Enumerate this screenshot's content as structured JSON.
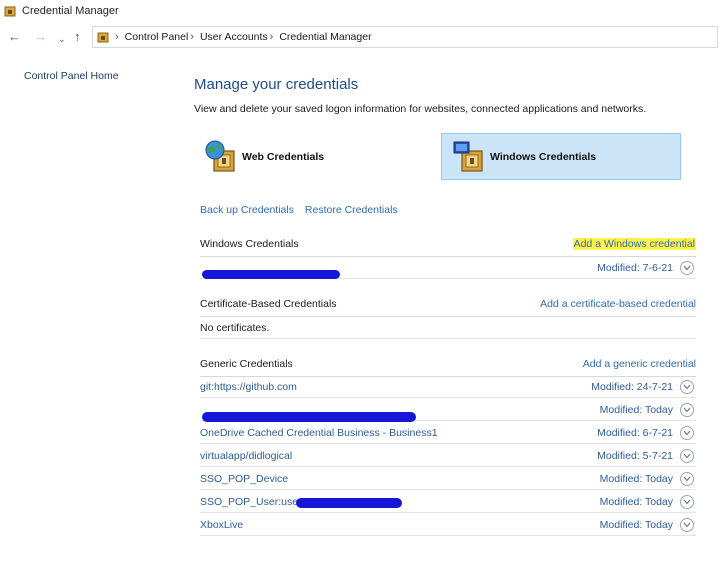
{
  "window": {
    "title": "Credential Manager"
  },
  "breadcrumb": {
    "items": [
      "Control Panel",
      "User Accounts",
      "Credential Manager"
    ]
  },
  "sidebar": {
    "home_link": "Control Panel Home"
  },
  "main": {
    "title": "Manage your credentials",
    "subtitle": "View and delete your saved logon information for websites, connected applications and networks.",
    "tiles": [
      {
        "label": "Web Credentials",
        "selected": false
      },
      {
        "label": "Windows Credentials",
        "selected": true
      }
    ],
    "actions": {
      "backup": "Back up Credentials",
      "restore": "Restore Credentials"
    }
  },
  "sections": {
    "windows": {
      "title": "Windows Credentials",
      "add": "Add a Windows credential",
      "rows": [
        {
          "name": "",
          "modified": "Modified:  7-6-21"
        }
      ]
    },
    "certificate": {
      "title": "Certificate-Based Credentials",
      "add": "Add a certificate-based credential",
      "empty": "No certificates."
    },
    "generic": {
      "title": "Generic Credentials",
      "add": "Add a generic credential",
      "rows": [
        {
          "name": "git:https://github.com",
          "modified": "Modified:  24-7-21"
        },
        {
          "name": "",
          "modified": "Modified:  Today"
        },
        {
          "name": "OneDrive Cached Credential Business - Business1",
          "modified": "Modified:  6-7-21"
        },
        {
          "name": "virtualapp/didlogical",
          "modified": "Modified:  5-7-21"
        },
        {
          "name": "SSO_POP_Device",
          "modified": "Modified:  Today"
        },
        {
          "name": "SSO_POP_User:user=",
          "modified": "Modified:  Today"
        },
        {
          "name": "XboxLive",
          "modified": "Modified:  Today"
        }
      ]
    }
  },
  "colors": {
    "highlight": "#fff04a",
    "selected_tile": "#cce4f7",
    "link": "#2f6bb5",
    "redaction": "#1616d8"
  },
  "icons": {
    "back": "←",
    "forward": "→",
    "recent": "⌄",
    "up": "↑",
    "separator": "›"
  }
}
